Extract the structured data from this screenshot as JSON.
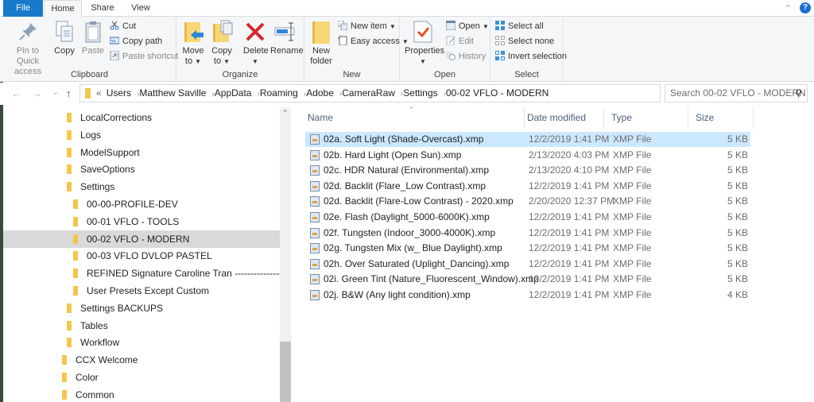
{
  "ribbon_tabs": {
    "file": "File",
    "home": "Home",
    "share": "Share",
    "view": "View"
  },
  "ribbon": {
    "clipboard": {
      "label": "Clipboard",
      "pin": "Pin to Quick access",
      "pin_line1": "Pin to Quick",
      "pin_line2": "access",
      "copy": "Copy",
      "paste": "Paste",
      "cut": "Cut",
      "copy_path": "Copy path",
      "paste_shortcut": "Paste shortcut"
    },
    "organize": {
      "label": "Organize",
      "move_to_1": "Move",
      "move_to_2": "to",
      "copy_to_1": "Copy",
      "copy_to_2": "to",
      "delete": "Delete",
      "rename": "Rename"
    },
    "new": {
      "label": "New",
      "new_folder_1": "New",
      "new_folder_2": "folder",
      "new_item": "New item",
      "easy_access": "Easy access"
    },
    "open": {
      "label": "Open",
      "properties": "Properties",
      "open": "Open",
      "edit": "Edit",
      "history": "History"
    },
    "select": {
      "label": "Select",
      "select_all": "Select all",
      "select_none": "Select none",
      "invert_selection": "Invert selection"
    }
  },
  "address": {
    "overflow": "«",
    "crumbs": [
      "Users",
      "Matthew Saville",
      "AppData",
      "Roaming",
      "Adobe",
      "CameraRaw",
      "Settings",
      "00-02 VFLO - MODERN"
    ]
  },
  "search": {
    "placeholder": "Search 00-02 VFLO - MODERN"
  },
  "nav_tree": [
    {
      "label": "LocalCorrections",
      "level": 2
    },
    {
      "label": "Logs",
      "level": 2
    },
    {
      "label": "ModelSupport",
      "level": 2
    },
    {
      "label": "SaveOptions",
      "level": 2
    },
    {
      "label": "Settings",
      "level": 2
    },
    {
      "label": "00-00-PROFILE-DEV",
      "level": 3
    },
    {
      "label": "00-01 VFLO - TOOLS",
      "level": 3
    },
    {
      "label": "00-02 VFLO - MODERN",
      "level": 3,
      "selected": true
    },
    {
      "label": "00-03 VFLO DVLOP PASTEL",
      "level": 3
    },
    {
      "label": "REFINED Signature Caroline Tran -----------------",
      "level": 3
    },
    {
      "label": "User Presets Except Custom",
      "level": 3
    },
    {
      "label": "Settings BACKUPS",
      "level": 2
    },
    {
      "label": "Tables",
      "level": 2
    },
    {
      "label": "Workflow",
      "level": 2
    },
    {
      "label": "CCX Welcome",
      "level": 1
    },
    {
      "label": "Color",
      "level": 1
    },
    {
      "label": "Common",
      "level": 1
    }
  ],
  "columns": {
    "name": "Name",
    "date": "Date modified",
    "type": "Type",
    "size": "Size"
  },
  "files": [
    {
      "name": "02a. Soft Light (Shade-Overcast).xmp",
      "date": "12/2/2019 1:41 PM",
      "type": "XMP File",
      "size": "5 KB",
      "selected": true
    },
    {
      "name": "02b. Hard Light (Open Sun).xmp",
      "date": "2/13/2020 4:03 PM",
      "type": "XMP File",
      "size": "5 KB"
    },
    {
      "name": "02c. HDR Natural (Environmental).xmp",
      "date": "2/13/2020 4:10 PM",
      "type": "XMP File",
      "size": "5 KB"
    },
    {
      "name": "02d. Backlit (Flare_Low Contrast).xmp",
      "date": "12/2/2019 1:41 PM",
      "type": "XMP File",
      "size": "5 KB"
    },
    {
      "name": "02d. Backlit (Flare-Low Contrast) - 2020.xmp",
      "date": "2/20/2020 12:37 PM",
      "type": "XMP File",
      "size": "5 KB"
    },
    {
      "name": "02e. Flash (Daylight_5000-6000K).xmp",
      "date": "12/2/2019 1:41 PM",
      "type": "XMP File",
      "size": "5 KB"
    },
    {
      "name": "02f. Tungsten (Indoor_3000-4000K).xmp",
      "date": "12/2/2019 1:41 PM",
      "type": "XMP File",
      "size": "5 KB"
    },
    {
      "name": "02g. Tungsten Mix (w_ Blue Daylight).xmp",
      "date": "12/2/2019 1:41 PM",
      "type": "XMP File",
      "size": "5 KB"
    },
    {
      "name": "02h. Over Saturated (Uplight_Dancing).xmp",
      "date": "12/2/2019 1:41 PM",
      "type": "XMP File",
      "size": "5 KB"
    },
    {
      "name": "02i. Green Tint (Nature_Fluorescent_Window).xmp",
      "date": "12/2/2019 1:41 PM",
      "type": "XMP File",
      "size": "5 KB"
    },
    {
      "name": "02j. B&W (Any light condition).xmp",
      "date": "12/2/2019 1:41 PM",
      "type": "XMP File",
      "size": "4 KB"
    }
  ],
  "icons": {
    "help": "?",
    "collapse": "^",
    "back": "←",
    "forward": "→",
    "recent": "⌄",
    "up": "↑",
    "refresh": "↻",
    "search": "⚲"
  },
  "colors": {
    "accent": "#1979ca",
    "selection": "#cce8ff",
    "nav_selection": "#d9d9d9",
    "folder": "#f5c64b"
  }
}
